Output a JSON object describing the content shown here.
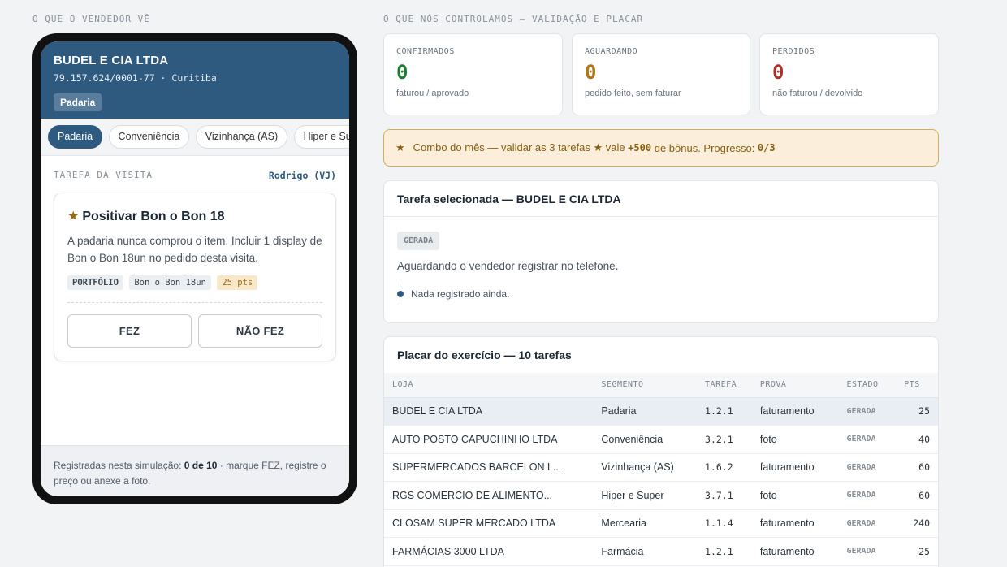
{
  "left_label": "O QUE O VENDEDOR VÊ",
  "right_label": "O QUE NÓS CONTROLAMOS — VALIDAÇÃO E PLACAR",
  "phone": {
    "company": "BUDEL E CIA LTDA",
    "sub": "79.157.624/0001-77 · Curitiba",
    "badge": "Padaria",
    "segments": [
      "Padaria",
      "Conveniência",
      "Vizinhança (AS)",
      "Hiper e Super"
    ],
    "task_label": "TAREFA DA VISITA",
    "task_user": "Rodrigo (VJ)",
    "card": {
      "star": "★",
      "title": "Positivar Bon o Bon 18",
      "desc": "A padaria nunca comprou o item. Incluir 1 display de Bon o Bon 18un no pedido desta visita.",
      "chips": [
        "PORTFÓLIO",
        "Bon o Bon 18un",
        "25 pts"
      ],
      "btn_done": "FEZ",
      "btn_not": "NÃO FEZ"
    },
    "footer_pre": "Registradas nesta simulação: ",
    "footer_bold": "0 de 10",
    "footer_post": " · marque FEZ, registre o preço ou anexe a foto."
  },
  "stats": [
    {
      "label": "CONFIRMADOS",
      "value": "0",
      "sub": "faturou / aprovado",
      "color": "#1f7a33"
    },
    {
      "label": "AGUARDANDO",
      "value": "0",
      "sub": "pedido feito, sem faturar",
      "color": "#b07814"
    },
    {
      "label": "PERDIDOS",
      "value": "0",
      "sub": "não faturou / devolvido",
      "color": "#a8322c"
    }
  ],
  "combo": {
    "star": "★",
    "text1": "Combo do mês — validar as 3 tarefas ★ vale ",
    "bonus": "+500",
    "text2": " de bônus. Progresso: ",
    "progress": "0/3"
  },
  "selected": {
    "title": "Tarefa selecionada — BUDEL E CIA LTDA",
    "badge": "GERADA",
    "text": "Aguardando o vendedor registrar no telefone.",
    "timeline": "Nada registrado ainda."
  },
  "placar": {
    "title": "Placar do exercício — 10 tarefas",
    "headers": [
      "LOJA",
      "SEGMENTO",
      "TAREFA",
      "PROVA",
      "ESTADO",
      "PTS"
    ],
    "rows": [
      [
        "BUDEL E CIA LTDA",
        "Padaria",
        "1.2.1",
        "faturamento",
        "GERADA",
        "25"
      ],
      [
        "AUTO POSTO CAPUCHINHO LTDA",
        "Conveniência",
        "3.2.1",
        "foto",
        "GERADA",
        "40"
      ],
      [
        "SUPERMERCADOS BARCELON L...",
        "Vizinhança (AS)",
        "1.6.2",
        "faturamento",
        "GERADA",
        "60"
      ],
      [
        "RGS COMERCIO DE ALIMENTO...",
        "Hiper e Super",
        "3.7.1",
        "foto",
        "GERADA",
        "60"
      ],
      [
        "CLOSAM SUPER MERCADO LTDA",
        "Mercearia",
        "1.1.4",
        "faturamento",
        "GERADA",
        "240"
      ],
      [
        "FARMÁCIAS 3000 LTDA",
        "Farmácia",
        "1.2.1",
        "faturamento",
        "GERADA",
        "25"
      ]
    ]
  }
}
